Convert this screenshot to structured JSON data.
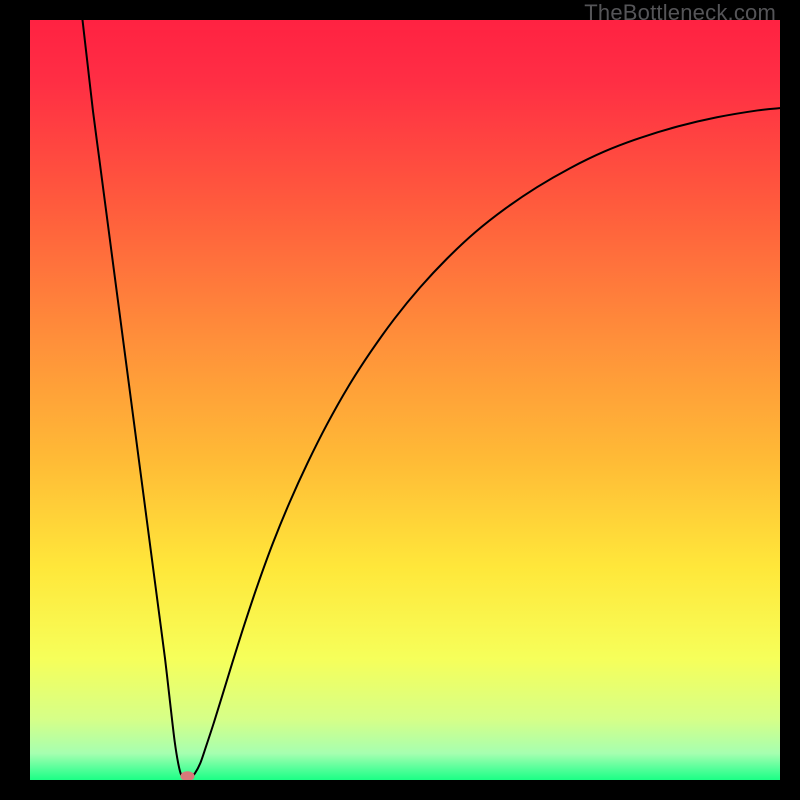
{
  "watermark": "TheBottleneck.com",
  "chart_data": {
    "type": "line",
    "title": "",
    "xlabel": "",
    "ylabel": "",
    "xlim": [
      0,
      100
    ],
    "ylim": [
      0,
      100
    ],
    "gradient_stops": [
      {
        "offset": 0.0,
        "color": "#ff2242"
      },
      {
        "offset": 0.08,
        "color": "#ff2e44"
      },
      {
        "offset": 0.24,
        "color": "#ff5a3d"
      },
      {
        "offset": 0.42,
        "color": "#ff8f3a"
      },
      {
        "offset": 0.58,
        "color": "#ffbb36"
      },
      {
        "offset": 0.72,
        "color": "#ffe73a"
      },
      {
        "offset": 0.84,
        "color": "#f6ff5a"
      },
      {
        "offset": 0.92,
        "color": "#d6ff88"
      },
      {
        "offset": 0.965,
        "color": "#a6ffb0"
      },
      {
        "offset": 0.985,
        "color": "#55ff9a"
      },
      {
        "offset": 1.0,
        "color": "#1cff85"
      }
    ],
    "annotations": [
      {
        "name": "marker",
        "x": 21,
        "y": 0.5,
        "color": "#d77a7a"
      }
    ],
    "series": [
      {
        "name": "curve",
        "color": "#000000",
        "data": [
          {
            "x": 7.0,
            "y": 100.0
          },
          {
            "x": 7.7,
            "y": 94.0
          },
          {
            "x": 8.4,
            "y": 88.0
          },
          {
            "x": 9.2,
            "y": 82.0
          },
          {
            "x": 10.0,
            "y": 76.0
          },
          {
            "x": 10.8,
            "y": 70.0
          },
          {
            "x": 11.6,
            "y": 64.0
          },
          {
            "x": 12.4,
            "y": 58.0
          },
          {
            "x": 13.2,
            "y": 52.0
          },
          {
            "x": 14.0,
            "y": 46.0
          },
          {
            "x": 14.8,
            "y": 40.0
          },
          {
            "x": 15.6,
            "y": 34.0
          },
          {
            "x": 16.4,
            "y": 28.0
          },
          {
            "x": 17.2,
            "y": 22.0
          },
          {
            "x": 18.0,
            "y": 16.0
          },
          {
            "x": 18.7,
            "y": 10.0
          },
          {
            "x": 19.3,
            "y": 5.0
          },
          {
            "x": 19.8,
            "y": 2.0
          },
          {
            "x": 20.2,
            "y": 0.6
          },
          {
            "x": 20.8,
            "y": 0.2
          },
          {
            "x": 21.4,
            "y": 0.3
          },
          {
            "x": 22.0,
            "y": 0.9
          },
          {
            "x": 22.7,
            "y": 2.2
          },
          {
            "x": 23.5,
            "y": 4.5
          },
          {
            "x": 24.5,
            "y": 7.5
          },
          {
            "x": 25.6,
            "y": 11.0
          },
          {
            "x": 27.0,
            "y": 15.5
          },
          {
            "x": 28.6,
            "y": 20.5
          },
          {
            "x": 30.4,
            "y": 25.8
          },
          {
            "x": 32.4,
            "y": 31.2
          },
          {
            "x": 34.6,
            "y": 36.5
          },
          {
            "x": 37.0,
            "y": 41.7
          },
          {
            "x": 39.6,
            "y": 46.8
          },
          {
            "x": 42.4,
            "y": 51.7
          },
          {
            "x": 45.4,
            "y": 56.3
          },
          {
            "x": 48.6,
            "y": 60.7
          },
          {
            "x": 52.0,
            "y": 64.8
          },
          {
            "x": 55.6,
            "y": 68.6
          },
          {
            "x": 59.4,
            "y": 72.1
          },
          {
            "x": 63.4,
            "y": 75.2
          },
          {
            "x": 67.6,
            "y": 78.0
          },
          {
            "x": 72.0,
            "y": 80.5
          },
          {
            "x": 76.6,
            "y": 82.7
          },
          {
            "x": 81.4,
            "y": 84.5
          },
          {
            "x": 86.4,
            "y": 86.0
          },
          {
            "x": 91.6,
            "y": 87.2
          },
          {
            "x": 97.0,
            "y": 88.1
          },
          {
            "x": 100.0,
            "y": 88.4
          }
        ]
      }
    ]
  }
}
